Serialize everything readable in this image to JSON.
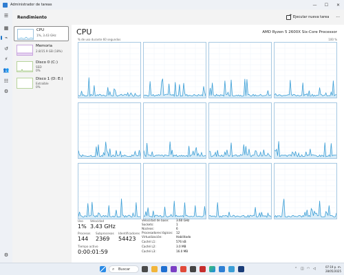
{
  "window": {
    "title": "Administrador de tareas",
    "controls": [
      "—",
      "☐",
      "✕"
    ]
  },
  "nav": {
    "items": [
      {
        "name": "menu-icon",
        "glyph": "☰"
      },
      {
        "name": "processes-icon",
        "glyph": "▦"
      },
      {
        "name": "performance-icon",
        "glyph": "⌁"
      },
      {
        "name": "app-history-icon",
        "glyph": "↺"
      },
      {
        "name": "startup-icon",
        "glyph": "⚡"
      },
      {
        "name": "users-icon",
        "glyph": "👥"
      },
      {
        "name": "details-icon",
        "glyph": "☷"
      },
      {
        "name": "services-icon",
        "glyph": "⚙"
      }
    ],
    "settings_glyph": "⚙"
  },
  "header": {
    "title": "Rendimiento",
    "new_task_label": "Ejecutar nueva tarea",
    "more_glyph": "···"
  },
  "resources": [
    {
      "name": "CPU",
      "sub1": "1%, 3.43 GHz",
      "sub2": ""
    },
    {
      "name": "Memoria",
      "sub1": "2.8/15.9 GB (18%)",
      "sub2": ""
    },
    {
      "name": "Disco 0 (C:)",
      "sub1": "SSD",
      "sub2": "0%"
    },
    {
      "name": "Disco 1 (D: E:)",
      "sub1": "Extraíble",
      "sub2": "0%"
    }
  ],
  "main": {
    "title": "CPU",
    "model": "AMD Ryzen 5 2600X Six-Core Processor",
    "util_label": "% de uso durante 60 segundos",
    "util_max": "100 %"
  },
  "stats": {
    "uso_label": "Uso",
    "uso_value": "1%",
    "velocidad_label": "Velocidad",
    "velocidad_value": "3.43 GHz",
    "procesos_label": "Procesos",
    "procesos_value": "144",
    "subprocesos_label": "Subprocesos",
    "subprocesos_value": "2369",
    "identificadores_label": "Identificadores",
    "identificadores_value": "54423",
    "tiempo_label": "Tiempo activo",
    "tiempo_value": "0:00:01:59"
  },
  "specs": [
    {
      "label": "Velocidad de base:",
      "value": "3.60 GHz"
    },
    {
      "label": "Sockets:",
      "value": "1"
    },
    {
      "label": "Núcleos:",
      "value": "6"
    },
    {
      "label": "Procesadores lógicos:",
      "value": "12"
    },
    {
      "label": "Virtualización:",
      "value": "Habilitado"
    },
    {
      "label": "Caché L1:",
      "value": "576 kB"
    },
    {
      "label": "Caché L2:",
      "value": "3.0 MB"
    },
    {
      "label": "Caché L3:",
      "value": "16.0 MB"
    }
  ],
  "taskbar": {
    "search_text": "Buscar",
    "time": "07:19 p. m.",
    "date": "28/05/2025"
  },
  "colors": {
    "accent": "#1a73c7",
    "graph_line": "#3b9ed6",
    "graph_fill": "#d7ebf7",
    "graph_border": "#a6c8e2"
  }
}
